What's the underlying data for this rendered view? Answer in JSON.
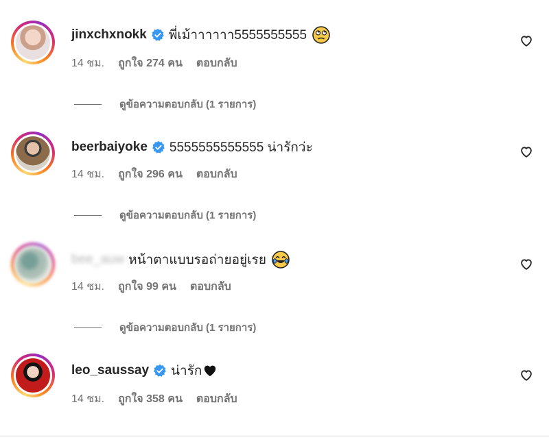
{
  "comments": [
    {
      "username": "jinxchxnokk",
      "text": "พี่เม้าาาาาา5555555555",
      "time": "14 ชม.",
      "likes": "ถูกใจ 274 คน",
      "reply": "ตอบกลับ",
      "view_replies": "ดูข้อความตอบกลับ (1 รายการ)",
      "emoji": "rolling-eyes-emoji"
    },
    {
      "username": "beerbaiyoke",
      "text": "5555555555555 น่ารักว่ะ",
      "time": "14 ชม.",
      "likes": "ถูกใจ 296 คน",
      "reply": "ตอบกลับ",
      "view_replies": "ดูข้อความตอบกลับ (1 รายการ)"
    },
    {
      "username": "bee_auw",
      "text": "หน้าตาแบบรอถ่ายอยู่เรย",
      "time": "14 ชม.",
      "likes": "ถูกใจ 99 คน",
      "reply": "ตอบกลับ",
      "view_replies": "ดูข้อความตอบกลับ (1 รายการ)",
      "emoji": "tears-of-joy-emoji"
    },
    {
      "username": "leo_saussay",
      "text": "น่ารัก",
      "time": "14 ชม.",
      "likes": "ถูกใจ 358 คน",
      "reply": "ตอบกลับ",
      "emoji": "black-heart-emoji"
    }
  ],
  "colors": {
    "verified": "#3897f0",
    "secondary_text": "#737373",
    "primary_text": "#262626"
  }
}
